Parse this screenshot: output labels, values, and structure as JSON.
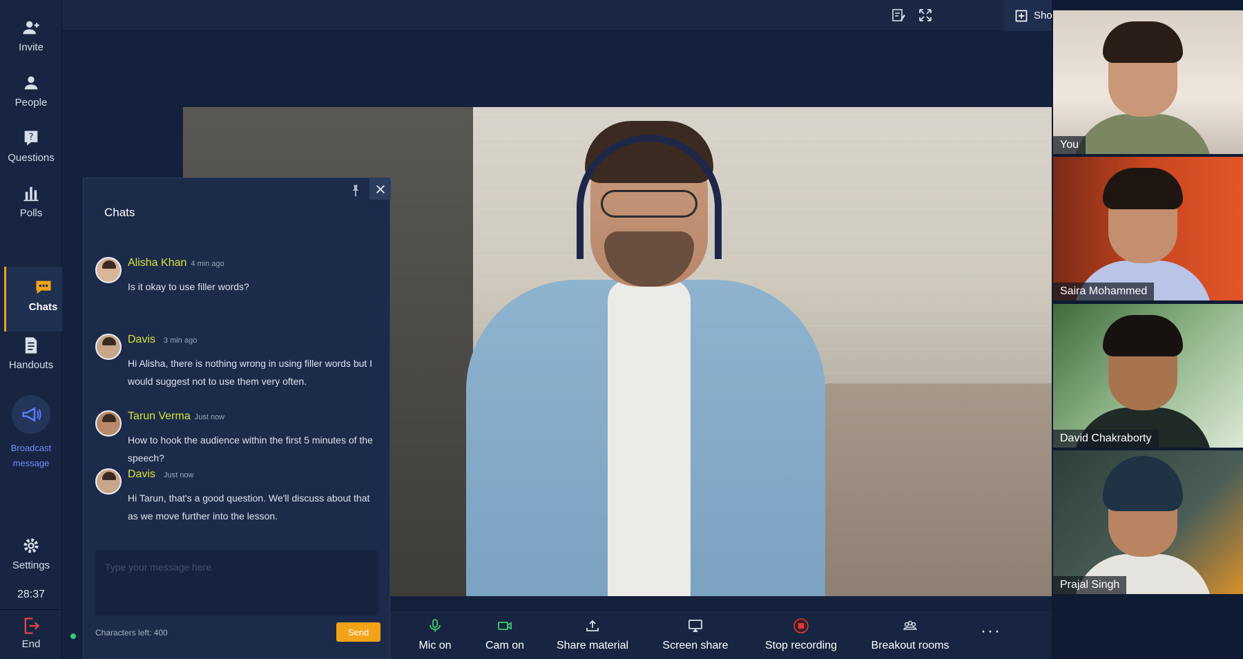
{
  "rail": {
    "invite": "Invite",
    "people": "People",
    "questions": "Questions",
    "polls": "Polls",
    "chats": "Chats",
    "handouts": "Handouts",
    "broadcast_line1": "Broadcast",
    "broadcast_line2": "message",
    "settings": "Settings",
    "timer": "28:37",
    "end": "End"
  },
  "topbar": {
    "show_all_slides": "Show all slides"
  },
  "chat": {
    "title": "Chats",
    "messages": [
      {
        "name": "Alisha Khan",
        "time": "4 min ago",
        "text": "Is it okay to use filler words?"
      },
      {
        "name": "Davis",
        "time": "3 min ago",
        "text": "Hi Alisha, there is nothing wrong in using filler words but I would suggest not to use them very often."
      },
      {
        "name": "Tarun Verma",
        "time": "Just now",
        "text": "How to hook the audience within the first 5 minutes of the speech?"
      },
      {
        "name": "Davis",
        "time": "Just now",
        "text": "Hi Tarun, that's a good question. We'll discuss about that as we move further into the lesson."
      }
    ],
    "placeholder": "Type your message here",
    "chars_left": "Characters left: 400",
    "send": "Send"
  },
  "toolbar": {
    "mic": "Mic on",
    "cam": "Cam on",
    "share_material": "Share material",
    "screen_share": "Screen share",
    "stop_recording": "Stop recording",
    "breakout_rooms": "Breakout rooms",
    "more": "···"
  },
  "participants": [
    {
      "name": "You"
    },
    {
      "name": "Saira Mohammed"
    },
    {
      "name": "David Chakraborty"
    },
    {
      "name": "Prajal Singh"
    }
  ],
  "colors": {
    "accent": "#f3a317",
    "name_highlight": "#d8e23a",
    "mic_green": "#3fcf6a",
    "record_red": "#e53935"
  }
}
